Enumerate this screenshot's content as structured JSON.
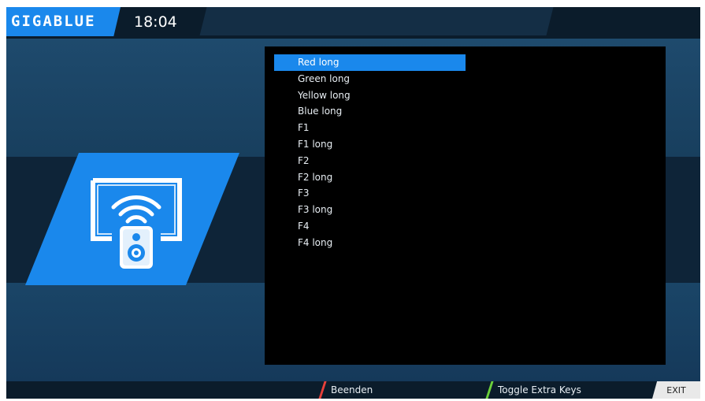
{
  "header": {
    "logo_text": "GIGABLUE",
    "clock": "18:04"
  },
  "key_list": {
    "selected_index": 0,
    "items": [
      {
        "label": "Red long"
      },
      {
        "label": "Green long"
      },
      {
        "label": "Yellow long"
      },
      {
        "label": "Blue long"
      },
      {
        "label": "F1"
      },
      {
        "label": "F1 long"
      },
      {
        "label": "F2"
      },
      {
        "label": "F2 long"
      },
      {
        "label": "F3"
      },
      {
        "label": "F3 long"
      },
      {
        "label": "F4"
      },
      {
        "label": "F4 long"
      }
    ]
  },
  "footer": {
    "red_label": "Beenden",
    "green_label": "Toggle Extra Keys",
    "exit_label": "EXIT"
  },
  "icons": {
    "panel_icon": "remote-wifi-icon"
  },
  "colors": {
    "accent": "#1a88ec",
    "red_key": "#e8403a",
    "green_key": "#6cd13b"
  }
}
